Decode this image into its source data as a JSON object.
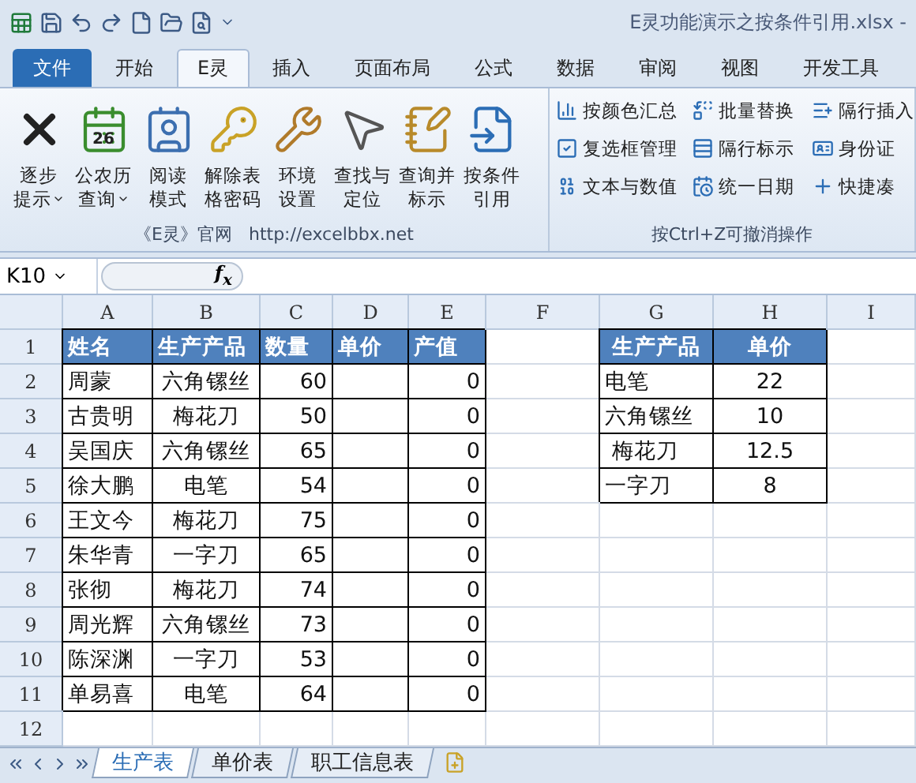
{
  "window": {
    "title": "E灵功能演示之按条件引用.xlsx -"
  },
  "tabs": [
    {
      "label": "文件",
      "selected": false,
      "kind": "file"
    },
    {
      "label": "开始",
      "selected": false,
      "kind": "tab"
    },
    {
      "label": "E灵",
      "selected": true,
      "kind": "tab"
    },
    {
      "label": "插入",
      "selected": false,
      "kind": "tab"
    },
    {
      "label": "页面布局",
      "selected": false,
      "kind": "tab"
    },
    {
      "label": "公式",
      "selected": false,
      "kind": "tab"
    },
    {
      "label": "数据",
      "selected": false,
      "kind": "tab"
    },
    {
      "label": "审阅",
      "selected": false,
      "kind": "tab"
    },
    {
      "label": "视图",
      "selected": false,
      "kind": "tab"
    },
    {
      "label": "开发工具",
      "selected": false,
      "kind": "tab"
    }
  ],
  "ribbon": {
    "large_buttons": [
      {
        "lines": [
          "逐步",
          "提示"
        ],
        "dropdown": true
      },
      {
        "lines": [
          "公农历",
          "查询"
        ],
        "dropdown": true,
        "badge": "26"
      },
      {
        "lines": [
          "阅读",
          "模式"
        ],
        "dropdown": false
      },
      {
        "lines": [
          "解除表",
          "格密码"
        ],
        "dropdown": false
      },
      {
        "lines": [
          "环境",
          "设置"
        ],
        "dropdown": false
      },
      {
        "lines": [
          "查找与",
          "定位"
        ],
        "dropdown": false
      },
      {
        "lines": [
          "查询并",
          "标示"
        ],
        "dropdown": false
      },
      {
        "lines": [
          "按条件",
          "引用"
        ],
        "dropdown": false
      }
    ],
    "group_label": "《E灵》官网   http://excelbbx.net",
    "small_buttons": [
      {
        "label": "按颜色汇总"
      },
      {
        "label": "批量替换"
      },
      {
        "label": "隔行插入"
      },
      {
        "label": "复选框管理"
      },
      {
        "label": "隔行标示"
      },
      {
        "label": "身份证"
      },
      {
        "label": "文本与数值"
      },
      {
        "label": "统一日期"
      },
      {
        "label": "快捷凑"
      }
    ],
    "group2_label": "按Ctrl+Z可撤消操作"
  },
  "formula_bar": {
    "name_box": "K10",
    "fx": "f$_{x}$"
  },
  "sheet": {
    "columns": [
      "A",
      "B",
      "C",
      "D",
      "E",
      "F",
      "G",
      "H",
      "I"
    ],
    "row_numbers": [
      "1",
      "2",
      "3",
      "4",
      "5",
      "6",
      "7",
      "8",
      "9",
      "10",
      "11",
      "12"
    ],
    "production_headers": [
      "姓名",
      "生产产品",
      "数量",
      "单价",
      "产值"
    ],
    "production_rows": [
      {
        "name": "周蒙",
        "product": "六角镙丝",
        "qty": "60",
        "value": "0"
      },
      {
        "name": "古贵明",
        "product": "梅花刀",
        "qty": "50",
        "value": "0"
      },
      {
        "name": "吴国庆",
        "product": "六角镙丝",
        "qty": "65",
        "value": "0"
      },
      {
        "name": "徐大鹏",
        "product": "电笔",
        "qty": "54",
        "value": "0"
      },
      {
        "name": "王文今",
        "product": "梅花刀",
        "qty": "75",
        "value": "0"
      },
      {
        "name": "朱华青",
        "product": "一字刀",
        "qty": "65",
        "value": "0"
      },
      {
        "name": "张彻",
        "product": "梅花刀",
        "qty": "74",
        "value": "0"
      },
      {
        "name": "周光辉",
        "product": "六角镙丝",
        "qty": "73",
        "value": "0"
      },
      {
        "name": "陈深渊",
        "product": "一字刀",
        "qty": "53",
        "value": "0"
      },
      {
        "name": "单易喜",
        "product": "电笔",
        "qty": "64",
        "value": "0"
      }
    ],
    "price_headers": [
      "生产产品",
      "单价"
    ],
    "price_rows": [
      {
        "product": "电笔",
        "price": "22"
      },
      {
        "product": "六角镙丝",
        "price": "10"
      },
      {
        "product": " 梅花刀",
        "price": "12.5"
      },
      {
        "product": "一字刀",
        "price": "8"
      }
    ]
  },
  "sheet_tabs": [
    {
      "label": "生产表",
      "selected": true
    },
    {
      "label": "单价表",
      "selected": false
    },
    {
      "label": "职工信息表",
      "selected": false
    }
  ]
}
